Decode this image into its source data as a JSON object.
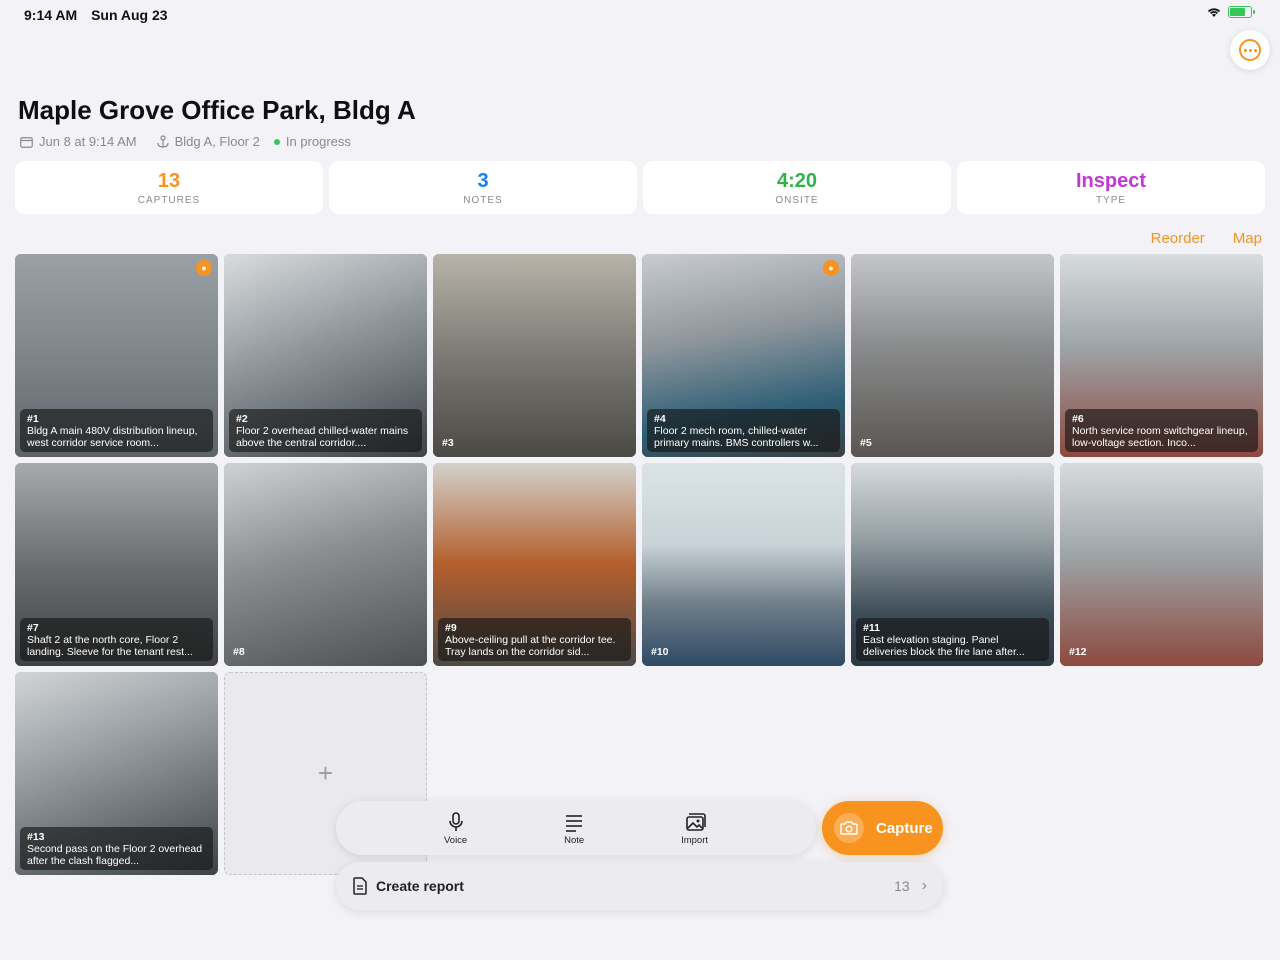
{
  "status_bar": {
    "time": "9:14 AM",
    "date": "Sun Aug 23",
    "battery_color": "#34c759"
  },
  "header": {
    "title": "Maple Grove Office Park, Bldg A",
    "date_text": "Jun 8 at 9:14 AM",
    "location_text": "Bldg A, Floor 2",
    "status_text": "In progress",
    "more_icon": "ellipsis-circle-icon"
  },
  "stats": [
    {
      "value": "13",
      "label": "CAPTURES",
      "color": "#f7931e"
    },
    {
      "value": "3",
      "label": "NOTES",
      "color": "#1a7fe8"
    },
    {
      "value": "4:20",
      "label": "ONSITE",
      "color": "#2fb24a"
    },
    {
      "value": "Inspect",
      "label": "TYPE",
      "color": "#c237d6"
    }
  ],
  "links": {
    "reorder": "Reorder",
    "map": "Map"
  },
  "captures": [
    {
      "num": "#1",
      "caption": "Bldg A main 480V distribution lineup, west corridor service room...",
      "has_voice": true
    },
    {
      "num": "#2",
      "caption": "Floor 2 overhead chilled-water mains above the central corridor....",
      "has_voice": false
    },
    {
      "num": "#3",
      "caption": "",
      "has_voice": false
    },
    {
      "num": "#4",
      "caption": "Floor 2 mech room, chilled-water primary mains. BMS controllers w...",
      "has_voice": true
    },
    {
      "num": "#5",
      "caption": "",
      "has_voice": false
    },
    {
      "num": "#6",
      "caption": "North service room switchgear lineup, low-voltage section. Inco...",
      "has_voice": false
    },
    {
      "num": "#7",
      "caption": "Shaft 2 at the north core, Floor 2 landing. Sleeve for the tenant rest...",
      "has_voice": false
    },
    {
      "num": "#8",
      "caption": "",
      "has_voice": false
    },
    {
      "num": "#9",
      "caption": "Above-ceiling pull at the corridor tee. Tray lands on the corridor sid...",
      "has_voice": false
    },
    {
      "num": "#10",
      "caption": "",
      "has_voice": false
    },
    {
      "num": "#11",
      "caption": "East elevation staging. Panel deliveries block the fire lane after...",
      "has_voice": false
    },
    {
      "num": "#12",
      "caption": "",
      "has_voice": false
    },
    {
      "num": "#13",
      "caption": "Second pass on the Floor 2 overhead after the clash flagged...",
      "has_voice": false
    }
  ],
  "add_tile": {
    "symbol": "+"
  },
  "toolbar": {
    "voice": "Voice",
    "note": "Note",
    "import": "Import",
    "capture": "Capture"
  },
  "report": {
    "label": "Create report",
    "count": "13"
  },
  "accent_color": "#f7931e"
}
